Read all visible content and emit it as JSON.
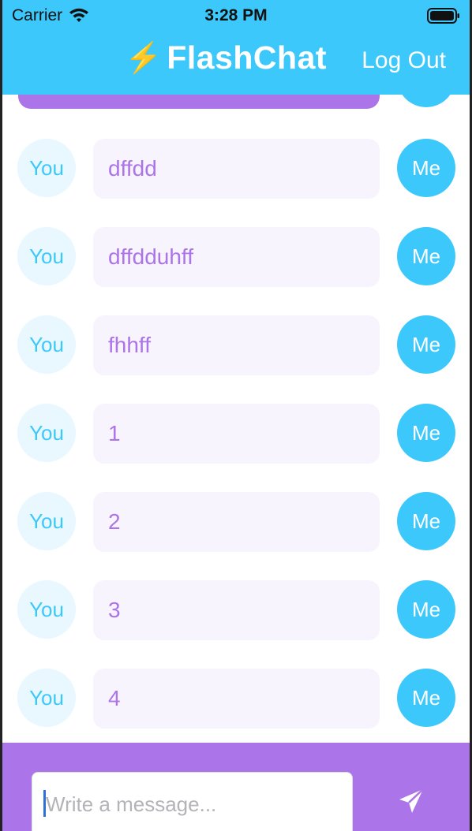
{
  "status_bar": {
    "carrier": "Carrier",
    "time": "3:28 PM",
    "icons": [
      "wifi-icon",
      "battery-icon"
    ]
  },
  "nav": {
    "bolt_glyph": "⚡",
    "title": "FlashChat",
    "logout_label": "Log Out"
  },
  "colors": {
    "accent_blue": "#3cc8fb",
    "accent_purple": "#ab74e9",
    "bubble_bg": "#f8f4fd",
    "you_avatar_bg": "#e9f8fe"
  },
  "messages": [
    {
      "left_avatar": "You",
      "text": "dffdd",
      "right_avatar": "Me"
    },
    {
      "left_avatar": "You",
      "text": "dffdduhff",
      "right_avatar": "Me"
    },
    {
      "left_avatar": "You",
      "text": "fhhff",
      "right_avatar": "Me"
    },
    {
      "left_avatar": "You",
      "text": "1",
      "right_avatar": "Me"
    },
    {
      "left_avatar": "You",
      "text": "2",
      "right_avatar": "Me"
    },
    {
      "left_avatar": "You",
      "text": "3",
      "right_avatar": "Me"
    },
    {
      "left_avatar": "You",
      "text": "4",
      "right_avatar": "Me"
    }
  ],
  "composer": {
    "placeholder": "Write a message...",
    "value": "",
    "send_icon": "send-icon"
  }
}
